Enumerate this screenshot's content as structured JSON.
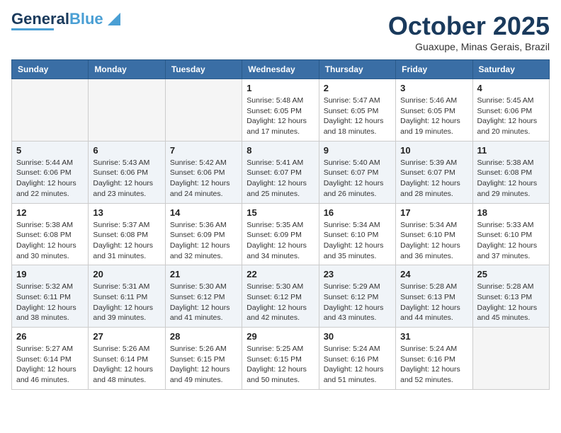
{
  "logo": {
    "line1": "General",
    "line2": "Blue"
  },
  "header": {
    "month": "October 2025",
    "location": "Guaxupe, Minas Gerais, Brazil"
  },
  "weekdays": [
    "Sunday",
    "Monday",
    "Tuesday",
    "Wednesday",
    "Thursday",
    "Friday",
    "Saturday"
  ],
  "weeks": [
    [
      {
        "day": "",
        "info": ""
      },
      {
        "day": "",
        "info": ""
      },
      {
        "day": "",
        "info": ""
      },
      {
        "day": "1",
        "info": "Sunrise: 5:48 AM\nSunset: 6:05 PM\nDaylight: 12 hours\nand 17 minutes."
      },
      {
        "day": "2",
        "info": "Sunrise: 5:47 AM\nSunset: 6:05 PM\nDaylight: 12 hours\nand 18 minutes."
      },
      {
        "day": "3",
        "info": "Sunrise: 5:46 AM\nSunset: 6:05 PM\nDaylight: 12 hours\nand 19 minutes."
      },
      {
        "day": "4",
        "info": "Sunrise: 5:45 AM\nSunset: 6:06 PM\nDaylight: 12 hours\nand 20 minutes."
      }
    ],
    [
      {
        "day": "5",
        "info": "Sunrise: 5:44 AM\nSunset: 6:06 PM\nDaylight: 12 hours\nand 22 minutes."
      },
      {
        "day": "6",
        "info": "Sunrise: 5:43 AM\nSunset: 6:06 PM\nDaylight: 12 hours\nand 23 minutes."
      },
      {
        "day": "7",
        "info": "Sunrise: 5:42 AM\nSunset: 6:06 PM\nDaylight: 12 hours\nand 24 minutes."
      },
      {
        "day": "8",
        "info": "Sunrise: 5:41 AM\nSunset: 6:07 PM\nDaylight: 12 hours\nand 25 minutes."
      },
      {
        "day": "9",
        "info": "Sunrise: 5:40 AM\nSunset: 6:07 PM\nDaylight: 12 hours\nand 26 minutes."
      },
      {
        "day": "10",
        "info": "Sunrise: 5:39 AM\nSunset: 6:07 PM\nDaylight: 12 hours\nand 28 minutes."
      },
      {
        "day": "11",
        "info": "Sunrise: 5:38 AM\nSunset: 6:08 PM\nDaylight: 12 hours\nand 29 minutes."
      }
    ],
    [
      {
        "day": "12",
        "info": "Sunrise: 5:38 AM\nSunset: 6:08 PM\nDaylight: 12 hours\nand 30 minutes."
      },
      {
        "day": "13",
        "info": "Sunrise: 5:37 AM\nSunset: 6:08 PM\nDaylight: 12 hours\nand 31 minutes."
      },
      {
        "day": "14",
        "info": "Sunrise: 5:36 AM\nSunset: 6:09 PM\nDaylight: 12 hours\nand 32 minutes."
      },
      {
        "day": "15",
        "info": "Sunrise: 5:35 AM\nSunset: 6:09 PM\nDaylight: 12 hours\nand 34 minutes."
      },
      {
        "day": "16",
        "info": "Sunrise: 5:34 AM\nSunset: 6:10 PM\nDaylight: 12 hours\nand 35 minutes."
      },
      {
        "day": "17",
        "info": "Sunrise: 5:34 AM\nSunset: 6:10 PM\nDaylight: 12 hours\nand 36 minutes."
      },
      {
        "day": "18",
        "info": "Sunrise: 5:33 AM\nSunset: 6:10 PM\nDaylight: 12 hours\nand 37 minutes."
      }
    ],
    [
      {
        "day": "19",
        "info": "Sunrise: 5:32 AM\nSunset: 6:11 PM\nDaylight: 12 hours\nand 38 minutes."
      },
      {
        "day": "20",
        "info": "Sunrise: 5:31 AM\nSunset: 6:11 PM\nDaylight: 12 hours\nand 39 minutes."
      },
      {
        "day": "21",
        "info": "Sunrise: 5:30 AM\nSunset: 6:12 PM\nDaylight: 12 hours\nand 41 minutes."
      },
      {
        "day": "22",
        "info": "Sunrise: 5:30 AM\nSunset: 6:12 PM\nDaylight: 12 hours\nand 42 minutes."
      },
      {
        "day": "23",
        "info": "Sunrise: 5:29 AM\nSunset: 6:12 PM\nDaylight: 12 hours\nand 43 minutes."
      },
      {
        "day": "24",
        "info": "Sunrise: 5:28 AM\nSunset: 6:13 PM\nDaylight: 12 hours\nand 44 minutes."
      },
      {
        "day": "25",
        "info": "Sunrise: 5:28 AM\nSunset: 6:13 PM\nDaylight: 12 hours\nand 45 minutes."
      }
    ],
    [
      {
        "day": "26",
        "info": "Sunrise: 5:27 AM\nSunset: 6:14 PM\nDaylight: 12 hours\nand 46 minutes."
      },
      {
        "day": "27",
        "info": "Sunrise: 5:26 AM\nSunset: 6:14 PM\nDaylight: 12 hours\nand 48 minutes."
      },
      {
        "day": "28",
        "info": "Sunrise: 5:26 AM\nSunset: 6:15 PM\nDaylight: 12 hours\nand 49 minutes."
      },
      {
        "day": "29",
        "info": "Sunrise: 5:25 AM\nSunset: 6:15 PM\nDaylight: 12 hours\nand 50 minutes."
      },
      {
        "day": "30",
        "info": "Sunrise: 5:24 AM\nSunset: 6:16 PM\nDaylight: 12 hours\nand 51 minutes."
      },
      {
        "day": "31",
        "info": "Sunrise: 5:24 AM\nSunset: 6:16 PM\nDaylight: 12 hours\nand 52 minutes."
      },
      {
        "day": "",
        "info": ""
      }
    ]
  ]
}
